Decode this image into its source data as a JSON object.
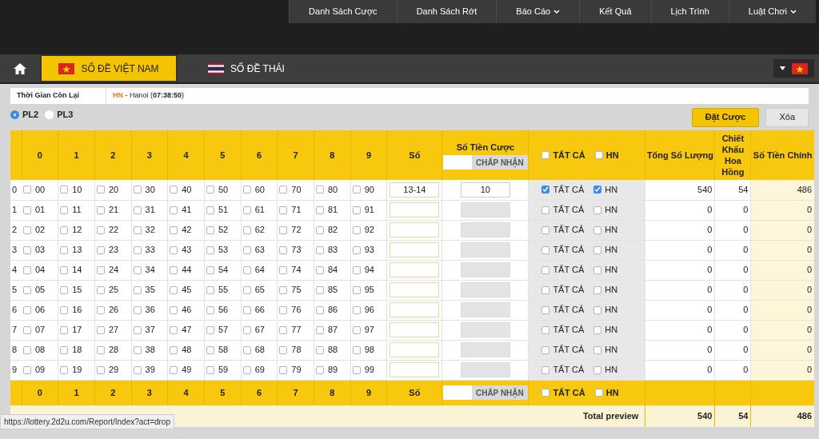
{
  "nav": [
    {
      "label": "Danh Sách Cược",
      "dropdown": false
    },
    {
      "label": "Danh Sách Rớt",
      "dropdown": false
    },
    {
      "label": "Báo Cáo",
      "dropdown": true
    },
    {
      "label": "Kết Quả",
      "dropdown": false
    },
    {
      "label": "Lịch Trình",
      "dropdown": false
    },
    {
      "label": "Luật Chơi",
      "dropdown": true
    }
  ],
  "tabs": [
    {
      "label": "SỐ ĐỀ VIỆT NAM",
      "kind": "vn",
      "selected": true
    },
    {
      "label": "SỐ ĐỀ THÁI",
      "kind": "th",
      "selected": false
    }
  ],
  "info": {
    "label": "Thời Gian Còn Lại",
    "region": "HN",
    "detail": "- Hanoi (**07:38:50**)"
  },
  "radios": [
    {
      "label": "PL2",
      "selected": true
    },
    {
      "label": "PL3",
      "selected": false
    }
  ],
  "buttons": [
    {
      "label": "Đặt Cược",
      "kind": "primary"
    },
    {
      "label": "Xóa",
      "kind": "secondary"
    }
  ],
  "header": {
    "digits": [
      "0",
      "1",
      "2",
      "3",
      "4",
      "5",
      "6",
      "7",
      "8",
      "9"
    ],
    "number": "Số",
    "amount": "Số Tiền Cược",
    "accept": "CHẤP NHẬN",
    "all": {
      "label": "TẤT CẢ",
      "checked": false
    },
    "hn": {
      "label": "HN",
      "checked": false
    },
    "total": "Tổng Số Lượng",
    "discount": "Chiết Khấu Hoa Hồng",
    "net": "Số Tiền Chính"
  },
  "rows": [
    {
      "index": "0",
      "cells": [
        {
          "label": "00",
          "checked": false
        },
        {
          "label": "10",
          "checked": false
        },
        {
          "label": "20",
          "checked": false
        },
        {
          "label": "30",
          "checked": false
        },
        {
          "label": "40",
          "checked": false
        },
        {
          "label": "50",
          "checked": false
        },
        {
          "label": "60",
          "checked": false
        },
        {
          "label": "70",
          "checked": false
        },
        {
          "label": "80",
          "checked": false
        },
        {
          "label": "90",
          "checked": false
        }
      ],
      "number": "13-14",
      "amount": "10",
      "amount_disabled": false,
      "all": {
        "label": "TẤT CẢ",
        "checked": true
      },
      "hn": {
        "label": "HN",
        "checked": true
      },
      "total": "540",
      "discount": "54",
      "net": "486"
    },
    {
      "index": "1",
      "cells": [
        {
          "label": "01",
          "checked": false
        },
        {
          "label": "11",
          "checked": false
        },
        {
          "label": "21",
          "checked": false
        },
        {
          "label": "31",
          "checked": false
        },
        {
          "label": "41",
          "checked": false
        },
        {
          "label": "51",
          "checked": false
        },
        {
          "label": "61",
          "checked": false
        },
        {
          "label": "71",
          "checked": false
        },
        {
          "label": "81",
          "checked": false
        },
        {
          "label": "91",
          "checked": false
        }
      ],
      "amount_disabled": true,
      "all": {
        "label": "TẤT CẢ",
        "checked": false
      },
      "hn": {
        "label": "HN",
        "checked": false
      },
      "total": "0",
      "discount": "0",
      "net": "0"
    },
    {
      "index": "2",
      "cells": [
        {
          "label": "02",
          "checked": false
        },
        {
          "label": "12",
          "checked": false
        },
        {
          "label": "22",
          "checked": false
        },
        {
          "label": "32",
          "checked": false
        },
        {
          "label": "42",
          "checked": false
        },
        {
          "label": "52",
          "checked": false
        },
        {
          "label": "62",
          "checked": false
        },
        {
          "label": "72",
          "checked": false
        },
        {
          "label": "82",
          "checked": false
        },
        {
          "label": "92",
          "checked": false
        }
      ],
      "amount_disabled": true,
      "all": {
        "label": "TẤT CẢ",
        "checked": false
      },
      "hn": {
        "label": "HN",
        "checked": false
      },
      "total": "0",
      "discount": "0",
      "net": "0"
    },
    {
      "index": "3",
      "cells": [
        {
          "label": "03",
          "checked": false
        },
        {
          "label": "13",
          "checked": false
        },
        {
          "label": "23",
          "checked": false
        },
        {
          "label": "33",
          "checked": false
        },
        {
          "label": "43",
          "checked": false
        },
        {
          "label": "53",
          "checked": false
        },
        {
          "label": "63",
          "checked": false
        },
        {
          "label": "73",
          "checked": false
        },
        {
          "label": "83",
          "checked": false
        },
        {
          "label": "93",
          "checked": false
        }
      ],
      "amount_disabled": true,
      "all": {
        "label": "TẤT CẢ",
        "checked": false
      },
      "hn": {
        "label": "HN",
        "checked": false
      },
      "total": "0",
      "discount": "0",
      "net": "0"
    },
    {
      "index": "4",
      "cells": [
        {
          "label": "04",
          "checked": false
        },
        {
          "label": "14",
          "checked": false
        },
        {
          "label": "24",
          "checked": false
        },
        {
          "label": "34",
          "checked": false
        },
        {
          "label": "44",
          "checked": false
        },
        {
          "label": "54",
          "checked": false
        },
        {
          "label": "64",
          "checked": false
        },
        {
          "label": "74",
          "checked": false
        },
        {
          "label": "84",
          "checked": false
        },
        {
          "label": "94",
          "checked": false
        }
      ],
      "amount_disabled": true,
      "all": {
        "label": "TẤT CẢ",
        "checked": false
      },
      "hn": {
        "label": "HN",
        "checked": false
      },
      "total": "0",
      "discount": "0",
      "net": "0"
    },
    {
      "index": "5",
      "cells": [
        {
          "label": "05",
          "checked": false
        },
        {
          "label": "15",
          "checked": false
        },
        {
          "label": "25",
          "checked": false
        },
        {
          "label": "35",
          "checked": false
        },
        {
          "label": "45",
          "checked": false
        },
        {
          "label": "55",
          "checked": false
        },
        {
          "label": "65",
          "checked": false
        },
        {
          "label": "75",
          "checked": false
        },
        {
          "label": "85",
          "checked": false
        },
        {
          "label": "95",
          "checked": false
        }
      ],
      "amount_disabled": true,
      "all": {
        "label": "TẤT CẢ",
        "checked": false
      },
      "hn": {
        "label": "HN",
        "checked": false
      },
      "total": "0",
      "discount": "0",
      "net": "0"
    },
    {
      "index": "6",
      "cells": [
        {
          "label": "06",
          "checked": false
        },
        {
          "label": "16",
          "checked": false
        },
        {
          "label": "26",
          "checked": false
        },
        {
          "label": "36",
          "checked": false
        },
        {
          "label": "46",
          "checked": false
        },
        {
          "label": "56",
          "checked": false
        },
        {
          "label": "66",
          "checked": false
        },
        {
          "label": "76",
          "checked": false
        },
        {
          "label": "86",
          "checked": false
        },
        {
          "label": "96",
          "checked": false
        }
      ],
      "amount_disabled": true,
      "all": {
        "label": "TẤT CẢ",
        "checked": false
      },
      "hn": {
        "label": "HN",
        "checked": false
      },
      "total": "0",
      "discount": "0",
      "net": "0"
    },
    {
      "index": "7",
      "cells": [
        {
          "label": "07",
          "checked": false
        },
        {
          "label": "17",
          "checked": false
        },
        {
          "label": "27",
          "checked": false
        },
        {
          "label": "37",
          "checked": false
        },
        {
          "label": "47",
          "checked": false
        },
        {
          "label": "57",
          "checked": false
        },
        {
          "label": "67",
          "checked": false
        },
        {
          "label": "77",
          "checked": false
        },
        {
          "label": "87",
          "checked": false
        },
        {
          "label": "97",
          "checked": false
        }
      ],
      "amount_disabled": true,
      "all": {
        "label": "TẤT CẢ",
        "checked": false
      },
      "hn": {
        "label": "HN",
        "checked": false
      },
      "total": "0",
      "discount": "0",
      "net": "0"
    },
    {
      "index": "8",
      "cells": [
        {
          "label": "08",
          "checked": false
        },
        {
          "label": "18",
          "checked": false
        },
        {
          "label": "28",
          "checked": false
        },
        {
          "label": "38",
          "checked": false
        },
        {
          "label": "48",
          "checked": false
        },
        {
          "label": "58",
          "checked": false
        },
        {
          "label": "68",
          "checked": false
        },
        {
          "label": "78",
          "checked": false
        },
        {
          "label": "88",
          "checked": false
        },
        {
          "label": "98",
          "checked": false
        }
      ],
      "amount_disabled": true,
      "all": {
        "label": "TẤT CẢ",
        "checked": false
      },
      "hn": {
        "label": "HN",
        "checked": false
      },
      "total": "0",
      "discount": "0",
      "net": "0"
    },
    {
      "index": "9",
      "cells": [
        {
          "label": "09",
          "checked": false
        },
        {
          "label": "19",
          "checked": false
        },
        {
          "label": "29",
          "checked": false
        },
        {
          "label": "39",
          "checked": false
        },
        {
          "label": "49",
          "checked": false
        },
        {
          "label": "59",
          "checked": false
        },
        {
          "label": "69",
          "checked": false
        },
        {
          "label": "79",
          "checked": false
        },
        {
          "label": "89",
          "checked": false
        },
        {
          "label": "99",
          "checked": false
        }
      ],
      "amount_disabled": true,
      "all": {
        "label": "TẤT CẢ",
        "checked": false
      },
      "hn": {
        "label": "HN",
        "checked": false
      },
      "total": "0",
      "discount": "0",
      "net": "0"
    }
  ],
  "footer": {
    "digits": [
      "0",
      "1",
      "2",
      "3",
      "4",
      "5",
      "6",
      "7",
      "8",
      "9"
    ],
    "number": "Số",
    "accept": "CHẤP NHẬN",
    "all": {
      "label": "TẤT CẢ",
      "checked": false
    },
    "hn": {
      "label": "HN",
      "checked": false
    }
  },
  "totals": {
    "label": "Total preview",
    "total": "540",
    "discount": "54",
    "net": "486"
  },
  "status_url": "https://lottery.2d2u.com/Report/Index?act=drop"
}
